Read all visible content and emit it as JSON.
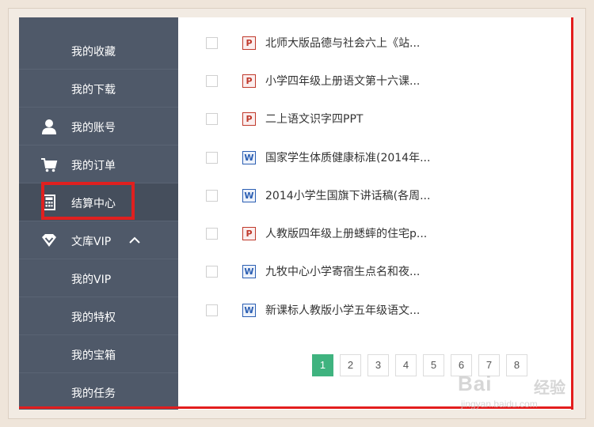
{
  "sidebar": {
    "items": [
      {
        "label": "我的收藏",
        "icon": ""
      },
      {
        "label": "我的下载",
        "icon": ""
      },
      {
        "label": "我的账号",
        "icon": "user-icon"
      },
      {
        "label": "我的订单",
        "icon": "cart-icon"
      },
      {
        "label": "结算中心",
        "icon": "calculator-icon",
        "active": true
      },
      {
        "label": "文库VIP",
        "icon": "diamond-icon",
        "expanded": true
      },
      {
        "label": "我的VIP",
        "icon": ""
      },
      {
        "label": "我的特权",
        "icon": ""
      },
      {
        "label": "我的宝箱",
        "icon": ""
      },
      {
        "label": "我的任务",
        "icon": ""
      }
    ],
    "background": "#4f5969",
    "highlight_color": "#e0201f"
  },
  "documents": [
    {
      "type": "P",
      "title": "北师大版品德与社会六上《站..."
    },
    {
      "type": "P",
      "title": "小学四年级上册语文第十六课..."
    },
    {
      "type": "P",
      "title": "二上语文识字四PPT"
    },
    {
      "type": "W",
      "title": "国家学生体质健康标准(2014年..."
    },
    {
      "type": "W",
      "title": "2014小学生国旗下讲话稿(各周..."
    },
    {
      "type": "P",
      "title": "人教版四年级上册蟋蟀的住宅p..."
    },
    {
      "type": "W",
      "title": "九牧中心小学寄宿生点名和夜..."
    },
    {
      "type": "W",
      "title": "新课标人教版小学五年级语文..."
    }
  ],
  "pagination": {
    "pages": [
      "1",
      "2",
      "3",
      "4",
      "5",
      "6",
      "7",
      "8"
    ],
    "current": "1",
    "accent": "#3fb37f"
  },
  "watermark": {
    "brand": "Bai",
    "brand2": "经验",
    "url": "jingyan.baidu.com"
  }
}
